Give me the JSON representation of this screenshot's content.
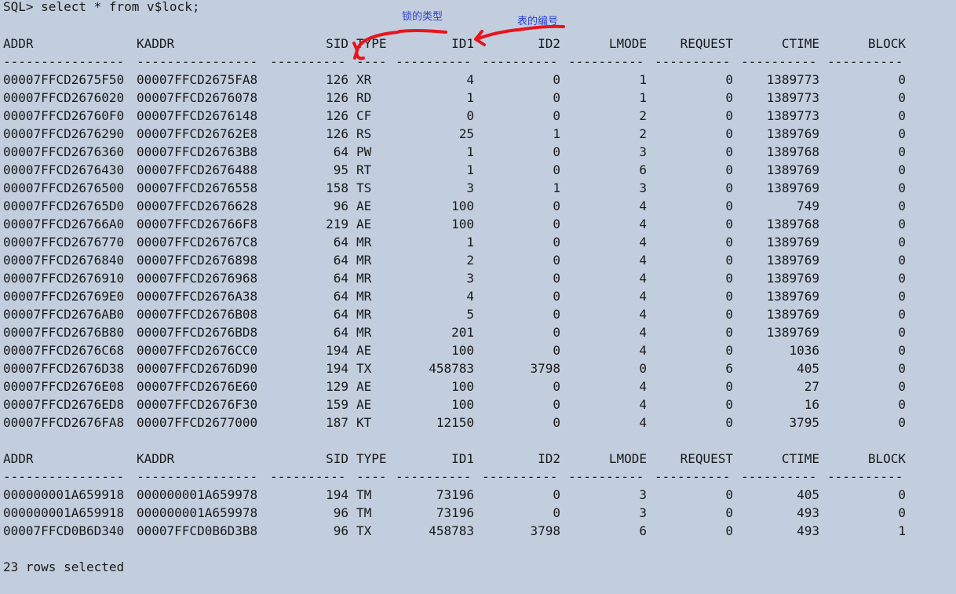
{
  "command": "SQL> select * from v$lock;",
  "headers": [
    "ADDR",
    "KADDR",
    "SID",
    "TYPE",
    "ID1",
    "ID2",
    "LMODE",
    "REQUEST",
    "CTIME",
    "BLOCK"
  ],
  "separator": [
    "----------------",
    "----------------",
    "----------",
    "----",
    "----------",
    "----------",
    "----------",
    "----------",
    "----------",
    "----------"
  ],
  "block1": [
    [
      "00007FFCD2675F50",
      "00007FFCD2675FA8",
      "126",
      "XR",
      "4",
      "0",
      "1",
      "0",
      "1389773",
      "0"
    ],
    [
      "00007FFCD2676020",
      "00007FFCD2676078",
      "126",
      "RD",
      "1",
      "0",
      "1",
      "0",
      "1389773",
      "0"
    ],
    [
      "00007FFCD26760F0",
      "00007FFCD2676148",
      "126",
      "CF",
      "0",
      "0",
      "2",
      "0",
      "1389773",
      "0"
    ],
    [
      "00007FFCD2676290",
      "00007FFCD26762E8",
      "126",
      "RS",
      "25",
      "1",
      "2",
      "0",
      "1389769",
      "0"
    ],
    [
      "00007FFCD2676360",
      "00007FFCD26763B8",
      "64",
      "PW",
      "1",
      "0",
      "3",
      "0",
      "1389768",
      "0"
    ],
    [
      "00007FFCD2676430",
      "00007FFCD2676488",
      "95",
      "RT",
      "1",
      "0",
      "6",
      "0",
      "1389769",
      "0"
    ],
    [
      "00007FFCD2676500",
      "00007FFCD2676558",
      "158",
      "TS",
      "3",
      "1",
      "3",
      "0",
      "1389769",
      "0"
    ],
    [
      "00007FFCD26765D0",
      "00007FFCD2676628",
      "96",
      "AE",
      "100",
      "0",
      "4",
      "0",
      "749",
      "0"
    ],
    [
      "00007FFCD26766A0",
      "00007FFCD26766F8",
      "219",
      "AE",
      "100",
      "0",
      "4",
      "0",
      "1389768",
      "0"
    ],
    [
      "00007FFCD2676770",
      "00007FFCD26767C8",
      "64",
      "MR",
      "1",
      "0",
      "4",
      "0",
      "1389769",
      "0"
    ],
    [
      "00007FFCD2676840",
      "00007FFCD2676898",
      "64",
      "MR",
      "2",
      "0",
      "4",
      "0",
      "1389769",
      "0"
    ],
    [
      "00007FFCD2676910",
      "00007FFCD2676968",
      "64",
      "MR",
      "3",
      "0",
      "4",
      "0",
      "1389769",
      "0"
    ],
    [
      "00007FFCD26769E0",
      "00007FFCD2676A38",
      "64",
      "MR",
      "4",
      "0",
      "4",
      "0",
      "1389769",
      "0"
    ],
    [
      "00007FFCD2676AB0",
      "00007FFCD2676B08",
      "64",
      "MR",
      "5",
      "0",
      "4",
      "0",
      "1389769",
      "0"
    ],
    [
      "00007FFCD2676B80",
      "00007FFCD2676BD8",
      "64",
      "MR",
      "201",
      "0",
      "4",
      "0",
      "1389769",
      "0"
    ],
    [
      "00007FFCD2676C68",
      "00007FFCD2676CC0",
      "194",
      "AE",
      "100",
      "0",
      "4",
      "0",
      "1036",
      "0"
    ],
    [
      "00007FFCD2676D38",
      "00007FFCD2676D90",
      "194",
      "TX",
      "458783",
      "3798",
      "0",
      "6",
      "405",
      "0"
    ],
    [
      "00007FFCD2676E08",
      "00007FFCD2676E60",
      "129",
      "AE",
      "100",
      "0",
      "4",
      "0",
      "27",
      "0"
    ],
    [
      "00007FFCD2676ED8",
      "00007FFCD2676F30",
      "159",
      "AE",
      "100",
      "0",
      "4",
      "0",
      "16",
      "0"
    ],
    [
      "00007FFCD2676FA8",
      "00007FFCD2677000",
      "187",
      "KT",
      "12150",
      "0",
      "4",
      "0",
      "3795",
      "0"
    ]
  ],
  "block2": [
    [
      "000000001A659918",
      "000000001A659978",
      "194",
      "TM",
      "73196",
      "0",
      "3",
      "0",
      "405",
      "0"
    ],
    [
      "000000001A659918",
      "000000001A659978",
      "96",
      "TM",
      "73196",
      "0",
      "3",
      "0",
      "493",
      "0"
    ],
    [
      "00007FFCD0B6D340",
      "00007FFCD0B6D3B8",
      "96",
      "TX",
      "458783",
      "3798",
      "6",
      "0",
      "493",
      "1"
    ]
  ],
  "footer": "23 rows selected",
  "annotations": {
    "lock_type": "锁的类型",
    "table_number": "表的编号",
    "color": "#e8141c",
    "text_color": "#2b3fd0"
  },
  "colors": {
    "background": "#c2cede",
    "text": "#1a1a1a"
  }
}
